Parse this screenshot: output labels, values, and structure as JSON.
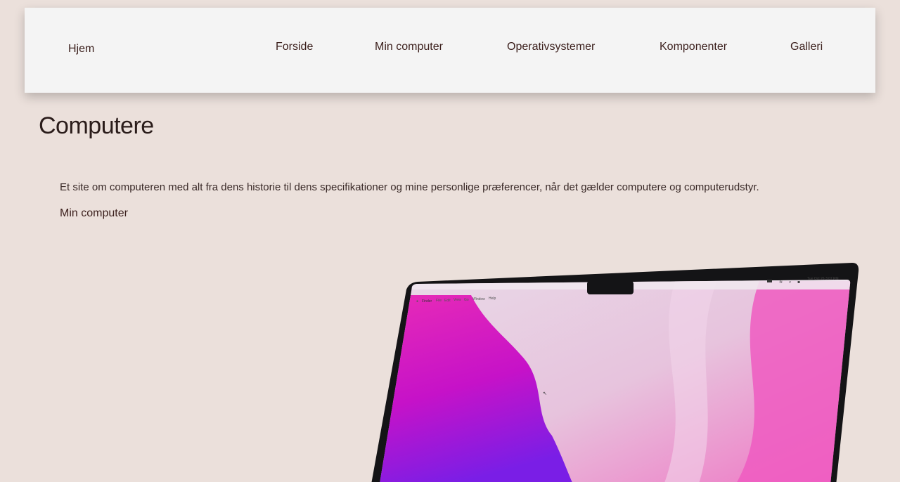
{
  "header": {
    "brand": "Hjem",
    "nav": [
      {
        "label": "Forside"
      },
      {
        "label": "Min computer"
      },
      {
        "label": "Operativsystemer"
      },
      {
        "label": "Komponenter"
      },
      {
        "label": "Galleri"
      }
    ]
  },
  "main": {
    "title": "Computere",
    "intro": "Et site om computeren med alt fra dens historie til dens specifikationer og mine personlige præferencer, når det gælder computere og computerudstyr.",
    "link_label": "Min computer"
  },
  "hero_image": {
    "menubar_items": [
      "Finder",
      "File",
      "Edit",
      "View",
      "Go",
      "Window",
      "Help"
    ],
    "clock": "Tue Oct 26  3:07 PM"
  },
  "colors": {
    "background": "#ebe0db",
    "header_bg": "#f4f4f4",
    "nav_text": "#3b1f1c"
  }
}
